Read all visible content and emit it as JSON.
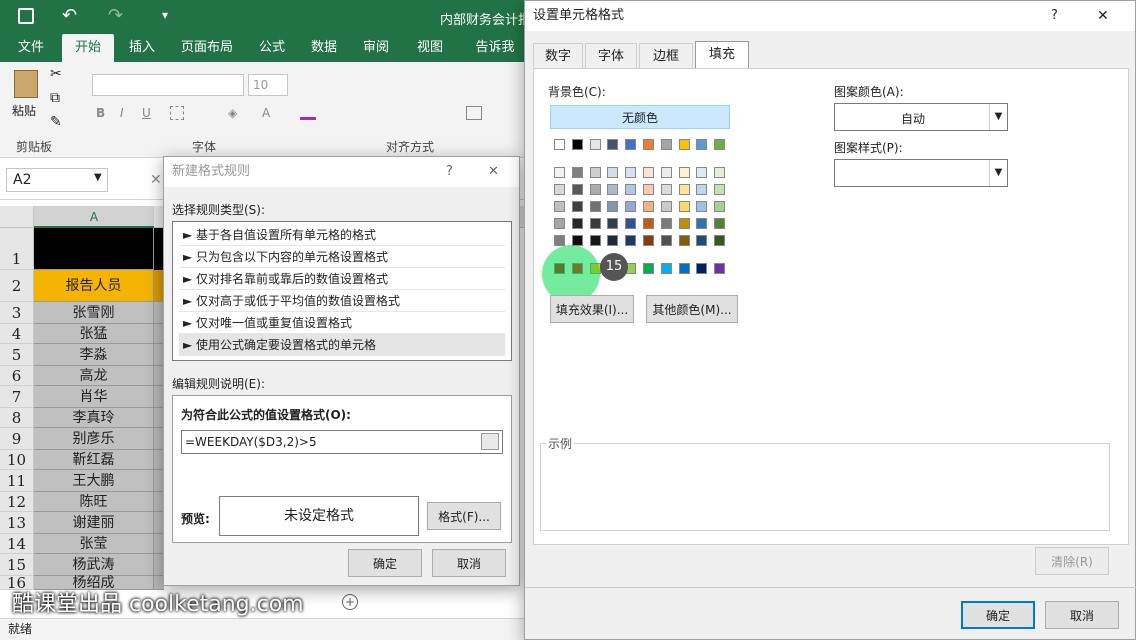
{
  "excel": {
    "title": "内部财务会计报",
    "ribbon_tabs": [
      "文件",
      "开始",
      "插入",
      "页面布局",
      "公式",
      "数据",
      "审阅",
      "视图",
      "告诉我"
    ],
    "group_labels": [
      "剪贴板",
      "字体",
      "对齐方式"
    ],
    "font_size": "10",
    "name_box": "A2",
    "paste_label": "粘贴",
    "column_a": "A",
    "rows": [
      "1",
      "2",
      "3",
      "4",
      "5",
      "6",
      "7",
      "8",
      "9",
      "10",
      "11",
      "12",
      "13",
      "14",
      "15",
      "16"
    ],
    "header_cell": "报告人员",
    "names": [
      "张雪刚",
      "张猛",
      "李淼",
      "高龙",
      "肖华",
      "李真玲",
      "别彦乐",
      "靳红磊",
      "王大鹏",
      "陈旺",
      "谢建丽",
      "张莹",
      "杨武涛",
      "杨绍成"
    ],
    "status": "就绪"
  },
  "rule_dialog": {
    "title": "新建格式规则",
    "help": "?",
    "close": "✕",
    "select_type_label": "选择规则类型(S):",
    "rule_types": [
      "► 基于各自值设置所有单元格的格式",
      "► 只为包含以下内容的单元格设置格式",
      "► 仅对排名靠前或靠后的数值设置格式",
      "► 仅对高于或低于平均值的数值设置格式",
      "► 仅对唯一值或重复值设置格式",
      "► 使用公式确定要设置格式的单元格"
    ],
    "edit_label": "编辑规则说明(E):",
    "formula_label": "为符合此公式的值设置格式(O):",
    "formula_value": "=WEEKDAY($D3,2)>5",
    "preview_label": "预览:",
    "preview_text": "未设定格式",
    "format_button": "格式(F)...",
    "ok": "确定",
    "cancel": "取消"
  },
  "format_dialog": {
    "title": "设置单元格格式",
    "help": "?",
    "close": "✕",
    "tabs": [
      "数字",
      "字体",
      "边框",
      "填充"
    ],
    "active_tab": "填充",
    "bg_color_label": "背景色(C):",
    "no_color": "无颜色",
    "pattern_color_label": "图案颜色(A):",
    "pattern_color_value": "自动",
    "pattern_style_label": "图案样式(P):",
    "fill_effects": "填充效果(I)...",
    "more_colors": "其他颜色(M)...",
    "sample_label": "示例",
    "clear": "清除(R)",
    "ok": "确定",
    "cancel": "取消",
    "theme_colors_top": [
      "#ffffff",
      "#000000",
      "#e7e6e6",
      "#44546a",
      "#4472c4",
      "#ed7d31",
      "#a5a5a5",
      "#ffc000",
      "#5b9bd5",
      "#70ad47"
    ],
    "theme_shades": [
      [
        "#f2f2f2",
        "#7f7f7f",
        "#d0cece",
        "#d6dce4",
        "#d9e2f3",
        "#fbe4d5",
        "#ededed",
        "#fff2cc",
        "#deebf6",
        "#e2efd9"
      ],
      [
        "#d8d8d8",
        "#595959",
        "#aeabab",
        "#adb9ca",
        "#b4c6e7",
        "#f7cbac",
        "#dbdbdb",
        "#fee599",
        "#bdd7ee",
        "#c5e0b3"
      ],
      [
        "#bfbfbf",
        "#3f3f3f",
        "#757070",
        "#8496b0",
        "#8eaadb",
        "#f4b183",
        "#c9c9c9",
        "#ffd965",
        "#9cc3e5",
        "#a8d08d"
      ],
      [
        "#a5a5a5",
        "#262626",
        "#3a3838",
        "#323f4f",
        "#2f5496",
        "#c55a11",
        "#7b7b7b",
        "#bf9000",
        "#2e75b5",
        "#538135"
      ],
      [
        "#7f7f7f",
        "#0c0c0c",
        "#171616",
        "#222a35",
        "#1f3864",
        "#833c0b",
        "#525252",
        "#7f6000",
        "#1e4e79",
        "#375623"
      ]
    ],
    "standard_colors": [
      "#c00000",
      "#ff0000",
      "#ffc000",
      "#ffff00",
      "#92d050",
      "#00b050",
      "#00b0f0",
      "#0070c0",
      "#002060",
      "#7030a0"
    ],
    "click_badge": "15"
  },
  "watermark": "酷课堂出品 coolketang.com"
}
